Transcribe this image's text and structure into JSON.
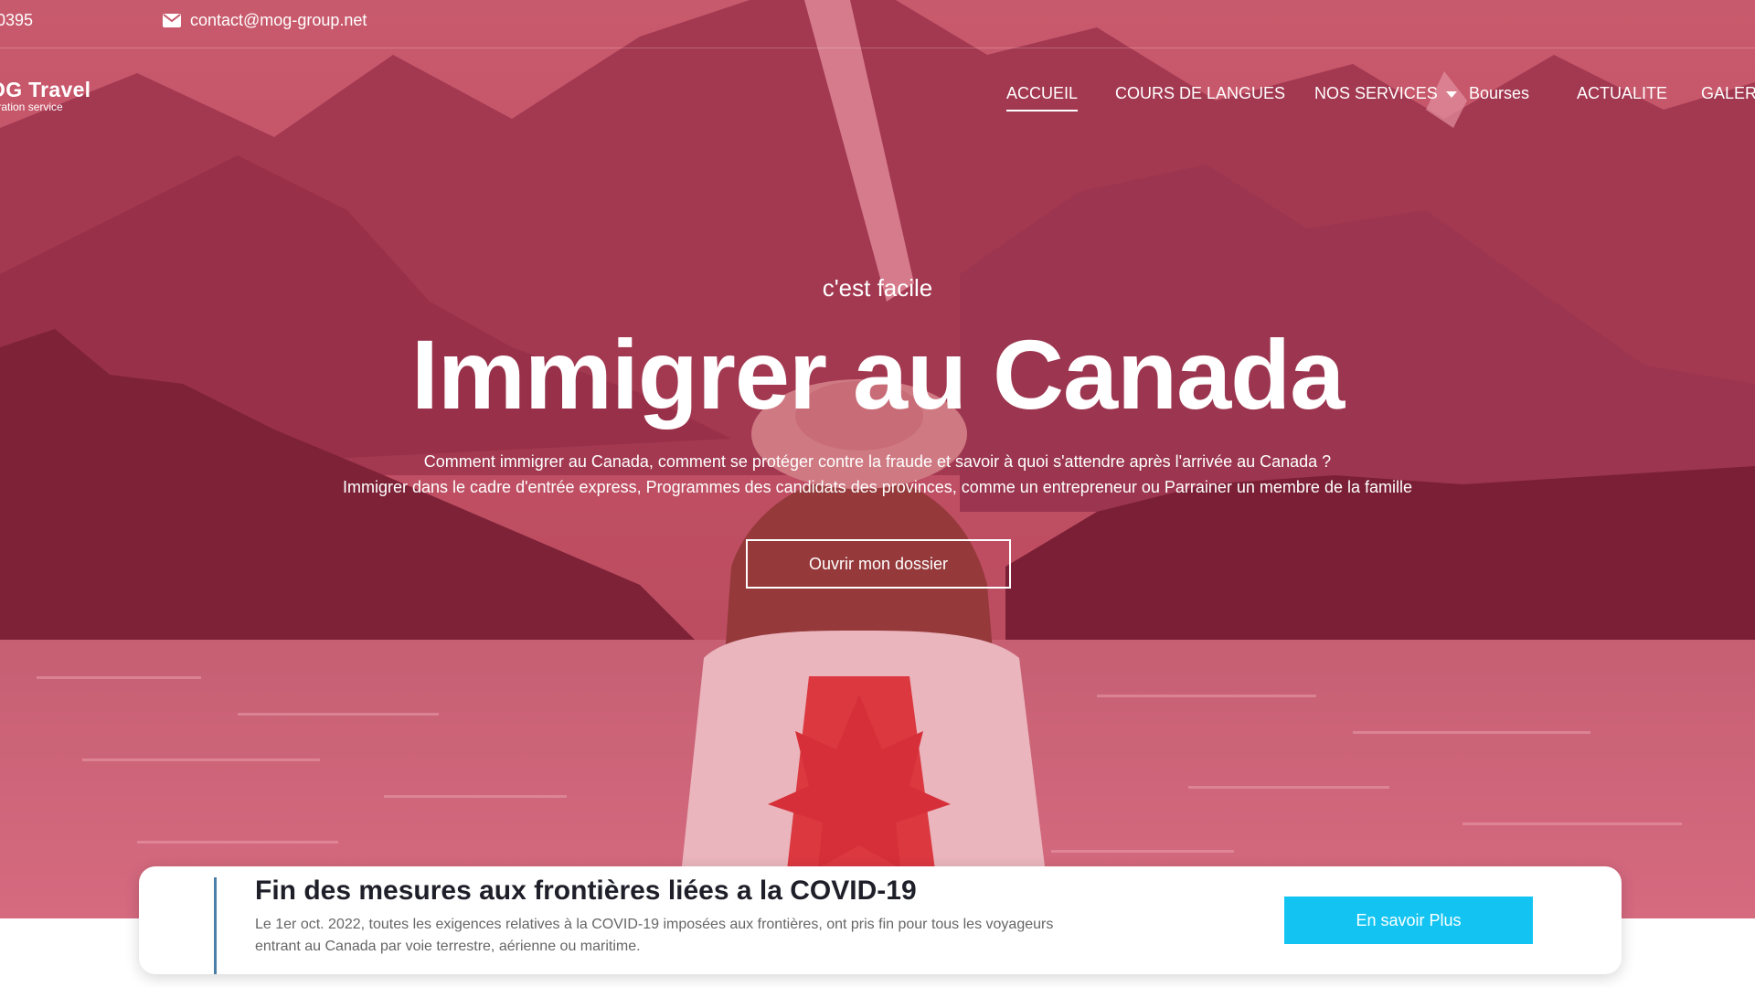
{
  "topbar": {
    "phone": "0395",
    "email": "contact@mog-group.net"
  },
  "logo": {
    "name": "OG Travel",
    "tagline": "igration service"
  },
  "nav": {
    "items": [
      {
        "label": "ACCUEIL",
        "active": true
      },
      {
        "label": "COURS DE LANGUES"
      },
      {
        "label": "NOS SERVICES",
        "has_dropdown": true
      },
      {
        "label": "Bourses"
      },
      {
        "label": "ACTUALITE"
      },
      {
        "label": "GALERI"
      }
    ]
  },
  "hero": {
    "kicker": "c'est facile",
    "title": "Immigrer au Canada",
    "desc_line1": "Comment immigrer au Canada, comment se protéger contre la fraude et savoir à quoi s'attendre après l'arrivée au Canada ?",
    "desc_line2": "Immigrer dans le cadre d'entrée express, Programmes des candidats des provinces, comme un entrepreneur ou Parrainer un membre de la famille",
    "button": "Ouvrir mon dossier"
  },
  "notice": {
    "title": "Fin des mesures aux frontières liées a la COVID-19",
    "text": "Le 1er oct. 2022, toutes les exigences relatives à la COVID-19 imposées aux frontières, ont pris fin pour tous les voyageurs entrant au Canada par voie terrestre, aérienne ou maritime.",
    "button": "En savoir Plus"
  },
  "colors": {
    "overlay": "#c8324c",
    "notice_button": "#13c4f2",
    "notice_accent": "#4a7fa8"
  }
}
